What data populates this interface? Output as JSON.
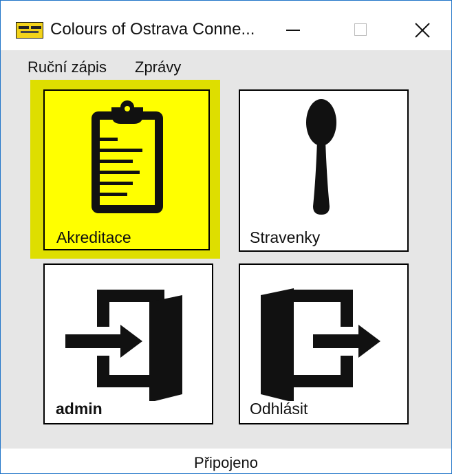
{
  "window": {
    "title": "Colours of Ostrava Conne...",
    "app_icon": "colours-of-ostrava-logo-icon",
    "controls": [
      "minimize-icon",
      "maximize-icon",
      "close-icon"
    ]
  },
  "menu": {
    "items": [
      {
        "label": "Ruční zápis"
      },
      {
        "label": "Zprávy"
      }
    ]
  },
  "tiles": [
    {
      "label": "Akreditace",
      "icon": "clipboard-icon",
      "selected": true,
      "background": "#ffff00"
    },
    {
      "label": "Stravenky",
      "icon": "spoon-icon",
      "selected": false
    },
    {
      "label": "admin",
      "icon": "sign-in-icon",
      "selected": false
    },
    {
      "label": "Odhlásit",
      "icon": "sign-out-icon",
      "selected": false
    }
  ],
  "status": {
    "text": "Připojeno"
  },
  "colors": {
    "selected_tile": "#ffff00",
    "selection_ring": "#dede00",
    "window_border": "#1e73c8"
  }
}
